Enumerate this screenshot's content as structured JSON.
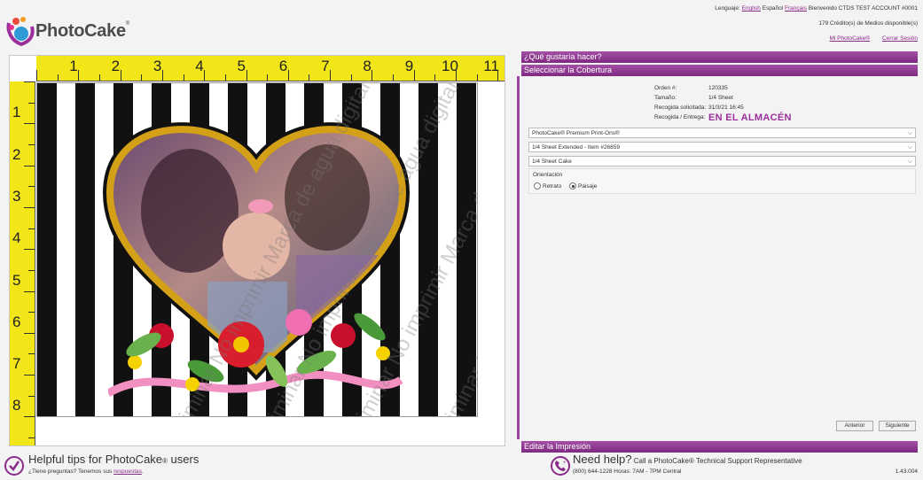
{
  "brand": {
    "name": "PhotoCake",
    "reg": "®"
  },
  "header": {
    "language_label": "Lenguaje:",
    "languages": [
      "English",
      "Español",
      "Français"
    ],
    "welcome": "Bienvenido CTDS TEST ACCOUNT #0001",
    "credits": "179 Crédito(s) de Medios disponible(s)",
    "my_photocake": "Mi PhotoCake®",
    "logout": "Cerrar Sesión"
  },
  "ruler": {
    "top": [
      "1",
      "2",
      "3",
      "4",
      "5",
      "6",
      "7",
      "8",
      "9",
      "10",
      "11"
    ],
    "left": [
      "1",
      "2",
      "3",
      "4",
      "5",
      "6",
      "7",
      "8"
    ]
  },
  "watermark_text": "Vista preliminar No imprimir Marca de agua digital",
  "sections": {
    "what": "¿Qué gustaría hacer?",
    "cover": "Seleccionar la Cobertura",
    "edit": "Editar la Impresión"
  },
  "order": {
    "order_label": "Orden #:",
    "order_value": "120335",
    "size_label": "Tamaño:",
    "size_value": "1/4 Sheet",
    "pickup_label": "Recogida solicitada:",
    "pickup_value": "31/3/21 16:45",
    "delivery_label": "Recogida / Entrega:",
    "delivery_value": "EN EL ALMACÉN"
  },
  "selects": [
    "PhotoCake® Premium Print-Ons®",
    "1/4 Sheet Extended - Item #26859",
    "1/4 Sheet Cake"
  ],
  "orientation": {
    "label": "Orientación",
    "portrait": "Retrato",
    "landscape": "Paisaje",
    "selected": "landscape"
  },
  "buttons": {
    "prev": "Anterior",
    "next": "Siguiente"
  },
  "footer": {
    "tips_title": "Helpful tips for PhotoCake",
    "tips_title_end": " users",
    "tips_sub": "¿Tiene preguntas? Tenemos sus ",
    "tips_link": "respuestas",
    "help_title": "Need help?",
    "help_sub_title": " Call a PhotoCake® Technical Support Representative",
    "help_phone": "(800) 644-1228 Horas: 7AM - 7PM Central",
    "version": "1.43.004"
  },
  "colors": {
    "accent": "#8a2c8a",
    "ruler": "#f2e518",
    "gold": "#d4a017"
  }
}
